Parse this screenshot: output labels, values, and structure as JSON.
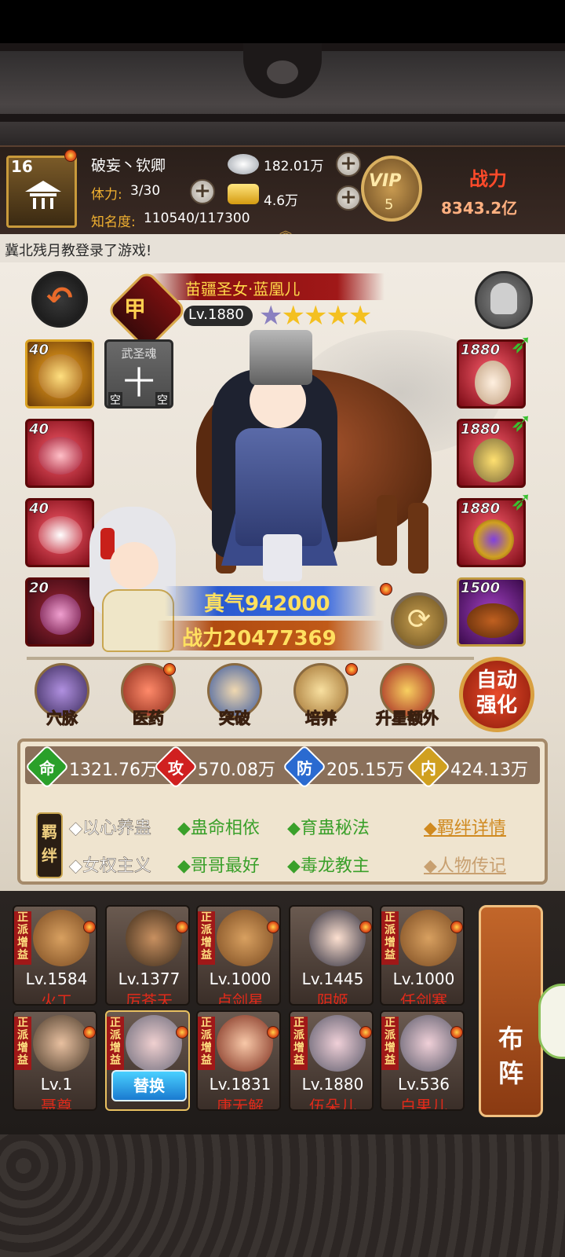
{
  "player": {
    "level": "16",
    "name": "破妄丶钦卿",
    "stamina_label": "体力:",
    "stamina_value": "3/30",
    "fame_label": "知名度:",
    "fame_value": "110540/117300",
    "silver": "182.01万",
    "gold": "4.6万",
    "vip_label": "VIP",
    "vip_level": "5",
    "power_label": "战力",
    "power_value": "8343.2亿"
  },
  "notice": "冀北残月教登录了游戏!",
  "hero": {
    "badge": "甲",
    "name": "苗疆圣女·蓝凰儿",
    "level": "Lv.1880",
    "stars": 5,
    "zhenqi": "真气942000",
    "power": "战力20477369"
  },
  "left_slots": [
    {
      "level": "40",
      "style": "gold"
    },
    {
      "label": "武圣魂",
      "glyph": "十",
      "empty_left": "空",
      "empty_right": "空"
    },
    {
      "level": "40",
      "style": "red"
    },
    {
      "level": "40",
      "style": "red"
    },
    {
      "level": "20",
      "style": "darkred"
    }
  ],
  "right_slots": [
    {
      "level": "1880"
    },
    {
      "level": "1880"
    },
    {
      "level": "1880"
    },
    {
      "level": "1500"
    }
  ],
  "functions": [
    {
      "label": "穴脉",
      "icon": "meridian-icon"
    },
    {
      "label": "医药",
      "icon": "medicine-icon"
    },
    {
      "label": "突破",
      "icon": "breakthrough-icon"
    },
    {
      "label": "培养",
      "icon": "cultivate-icon"
    },
    {
      "label": "升星额外",
      "icon": "star-up-icon"
    }
  ],
  "auto_strengthen": "自动强化",
  "stats": [
    {
      "key": "命",
      "value": "1321.76万",
      "color": "#2aa02a"
    },
    {
      "key": "攻",
      "value": "570.08万",
      "color": "#d02020"
    },
    {
      "key": "防",
      "value": "205.15万",
      "color": "#2a6ad0"
    },
    {
      "key": "内",
      "value": "424.13万",
      "color": "#d0a020"
    }
  ],
  "bond_tag": "羁绊",
  "bonds_row1": [
    {
      "text": "◆以心养蛊",
      "color": "white"
    },
    {
      "text": "◆蛊命相依",
      "color": "green"
    },
    {
      "text": "◆育蛊秘法",
      "color": "green"
    }
  ],
  "bonds_row2": [
    {
      "text": "◆女权主义",
      "color": "white"
    },
    {
      "text": "◆哥哥最好",
      "color": "green"
    },
    {
      "text": "◆毒龙教主",
      "color": "green"
    }
  ],
  "links": {
    "bond_detail": "◆羁绊详情",
    "biography": "◆人物传记"
  },
  "team_tag": "正派增益",
  "team": [
    {
      "level": "Lv.1584",
      "name": "火工"
    },
    {
      "level": "Lv.1377",
      "name": "厉苍天"
    },
    {
      "level": "Lv.1000",
      "name": "卢剑星"
    },
    {
      "level": "Lv.1445",
      "name": "阴姬"
    },
    {
      "level": "Lv.1000",
      "name": "任剑寒"
    },
    {
      "level": "Lv.1",
      "name": "聂尊"
    },
    {
      "level": "",
      "name": "",
      "replace": "替换"
    },
    {
      "level": "Lv.1831",
      "name": "唐无解"
    },
    {
      "level": "Lv.1880",
      "name": "伍朵儿"
    },
    {
      "level": "Lv.536",
      "name": "白果儿"
    }
  ],
  "formation": "布阵"
}
